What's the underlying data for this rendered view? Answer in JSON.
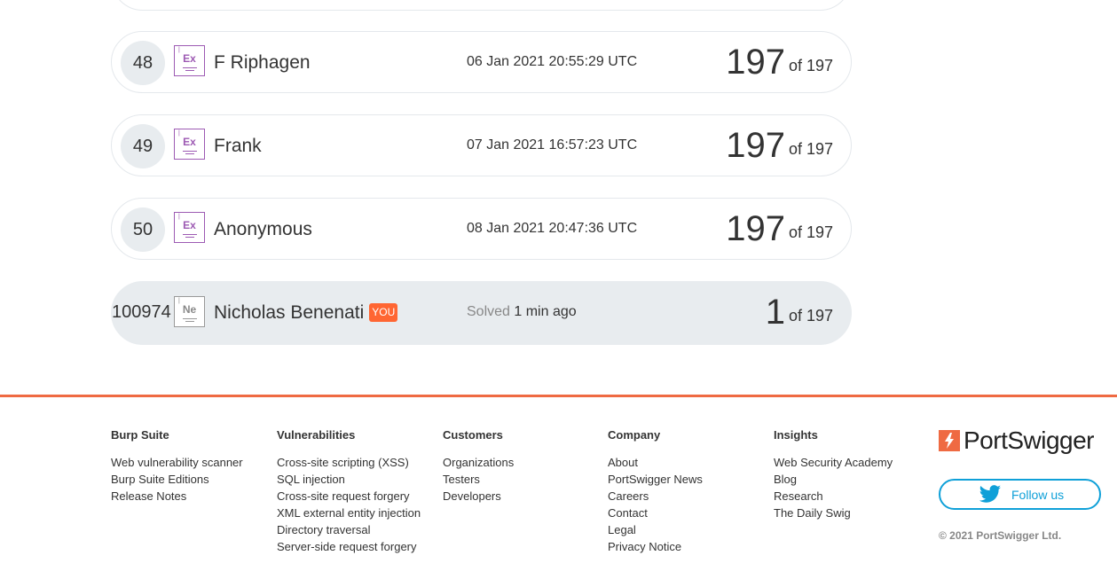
{
  "leaderboard": {
    "rows": [
      {
        "rank": "48",
        "badge": "Ex",
        "name": "F Riphagen",
        "date": "06 Jan 2021 20:55:29 UTC",
        "score": "197",
        "of_label": "of 197"
      },
      {
        "rank": "49",
        "badge": "Ex",
        "name": "Frank",
        "date": "07 Jan 2021 16:57:23 UTC",
        "score": "197",
        "of_label": "of 197"
      },
      {
        "rank": "50",
        "badge": "Ex",
        "name": "Anonymous",
        "date": "08 Jan 2021 20:47:36 UTC",
        "score": "197",
        "of_label": "of 197"
      }
    ],
    "current_user": {
      "rank": "100974",
      "badge": "Ne",
      "name": "Nicholas Benenati",
      "you_tag": "YOU",
      "solved_label": "Solved",
      "solved_time": "1 min ago",
      "score": "1",
      "of_label": "of 197"
    }
  },
  "footer": {
    "accent_color": "#ef6a42",
    "columns": [
      {
        "heading": "Burp Suite",
        "links": [
          "Web vulnerability scanner",
          "Burp Suite Editions",
          "Release Notes"
        ]
      },
      {
        "heading": "Vulnerabilities",
        "links": [
          "Cross-site scripting (XSS)",
          "SQL injection",
          "Cross-site request forgery",
          "XML external entity injection",
          "Directory traversal",
          "Server-side request forgery"
        ]
      },
      {
        "heading": "Customers",
        "links": [
          "Organizations",
          "Testers",
          "Developers"
        ]
      },
      {
        "heading": "Company",
        "links": [
          "About",
          "PortSwigger News",
          "Careers",
          "Contact",
          "Legal",
          "Privacy Notice"
        ]
      },
      {
        "heading": "Insights",
        "links": [
          "Web Security Academy",
          "Blog",
          "Research",
          "The Daily Swig"
        ]
      }
    ],
    "logo_text": "PortSwigger",
    "follow_label": "Follow us",
    "copyright": "© 2021 PortSwigger Ltd."
  }
}
